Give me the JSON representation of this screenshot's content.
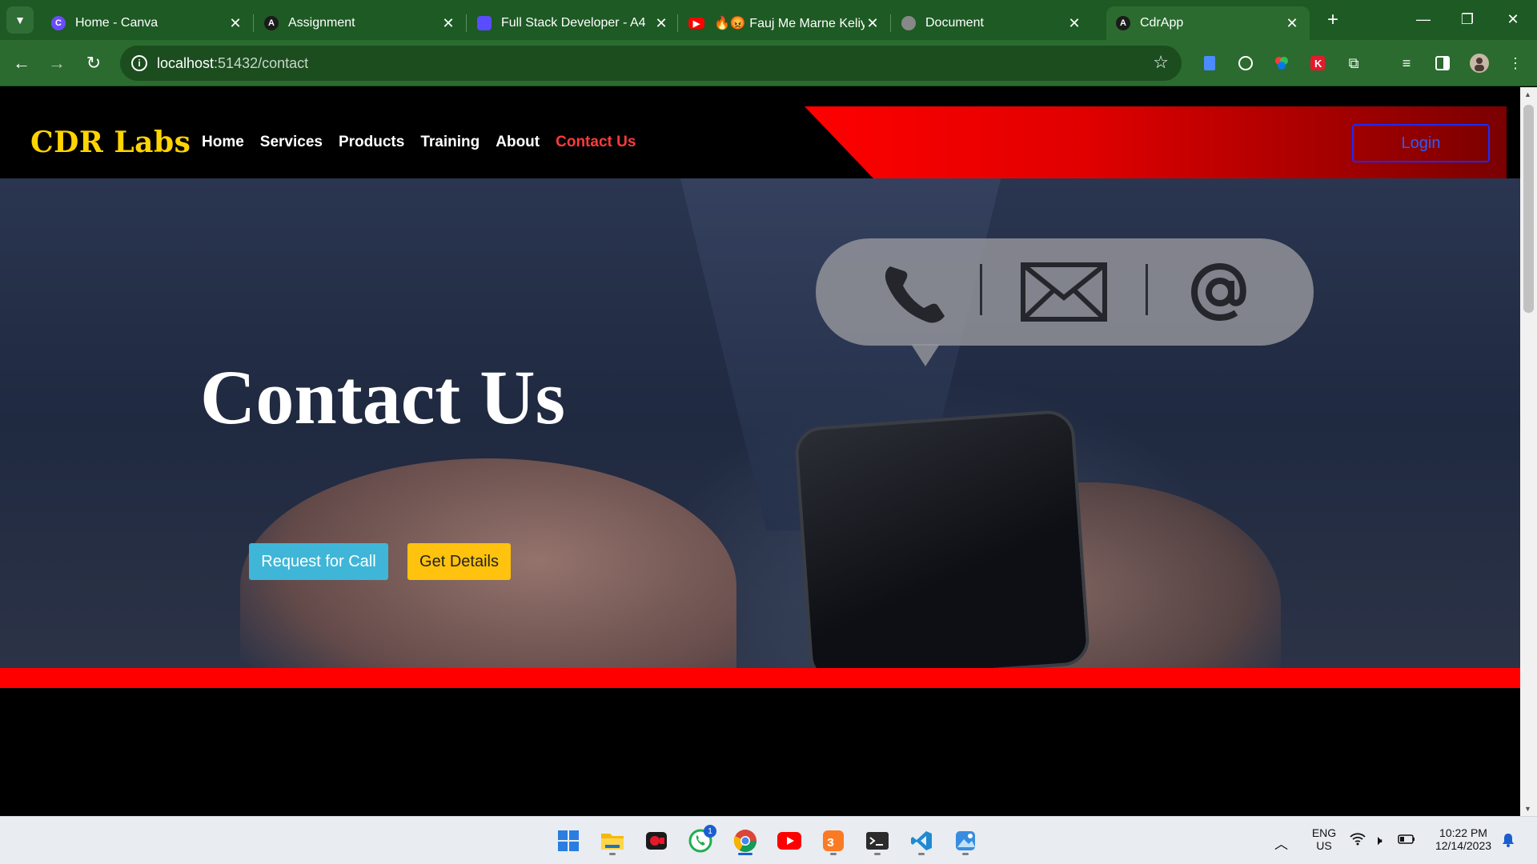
{
  "browser": {
    "tabs": [
      {
        "title": "Home - Canva",
        "favicon": "canva-icon",
        "color": "#6a4cff"
      },
      {
        "title": "Assignment",
        "favicon": "angular-icon",
        "color": "#1b1b1b"
      },
      {
        "title": "Full Stack Developer - A4",
        "favicon": "document-icon",
        "color": "#5a4cff"
      },
      {
        "title": "🔥😡 Fauj Me Marne Keliy",
        "favicon": "youtube-icon",
        "color": "#ff0000"
      },
      {
        "title": "Document",
        "favicon": "globe-icon",
        "color": "#888888"
      },
      {
        "title": "CdrApp",
        "favicon": "angular-icon",
        "color": "#1b1b1b"
      }
    ],
    "active_tab": 5,
    "url_host": "localhost",
    "url_path": ":51432/contact"
  },
  "site": {
    "brand": "CDR Labs",
    "nav": [
      {
        "label": "Home"
      },
      {
        "label": "Services"
      },
      {
        "label": "Products"
      },
      {
        "label": "Training"
      },
      {
        "label": "About"
      },
      {
        "label": "Contact Us"
      }
    ],
    "login_label": "Login",
    "hero": {
      "title": "Contact Us",
      "request_call_label": "Request for Call",
      "get_details_label": "Get Details",
      "icons": [
        "phone-icon",
        "envelope-icon",
        "at-sign-icon"
      ]
    }
  },
  "taskbar": {
    "apps": [
      "windows-start-icon",
      "file-explorer-icon",
      "screen-recorder-icon",
      "whatsapp-icon",
      "chrome-icon",
      "youtube-icon",
      "xampp-icon",
      "terminal-icon",
      "vscode-icon",
      "photos-icon"
    ],
    "whatsapp_badge": "1",
    "lang_line1": "ENG",
    "lang_line2": "US",
    "time": "10:22 PM",
    "date": "12/14/2023"
  },
  "colors": {
    "brand_yellow": "#ffd400",
    "accent_red": "#ff0000",
    "active_nav": "#ff3b3b",
    "call_button": "#3fb6d8",
    "details_button": "#ffc20e",
    "login_border": "#1a2cff",
    "chrome_green": "#2b6b2f"
  }
}
